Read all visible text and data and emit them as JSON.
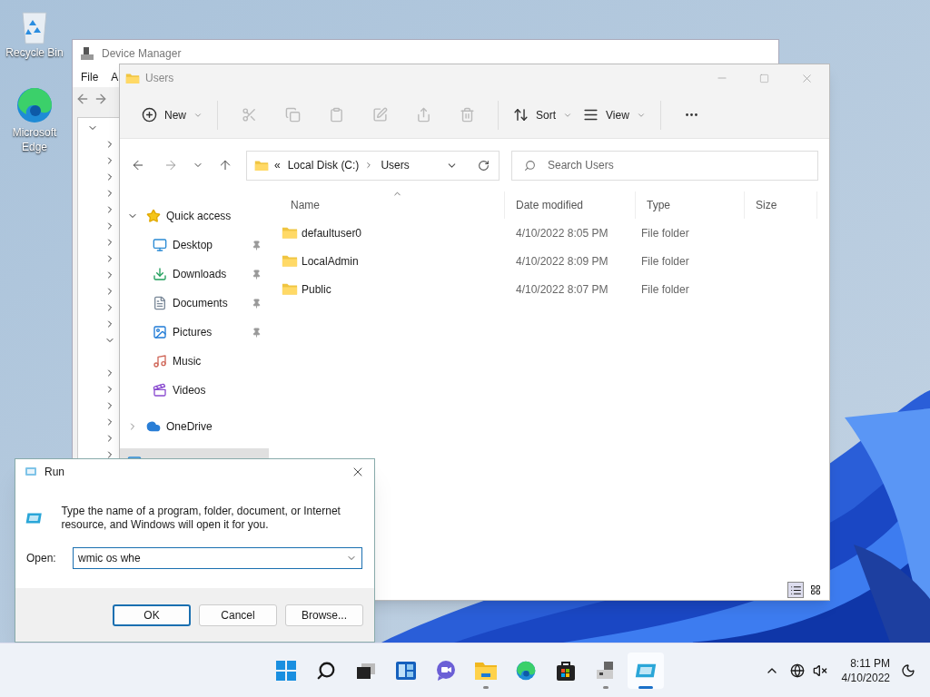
{
  "desktop": {
    "icons": [
      {
        "kind": "recycle",
        "label": "Recycle Bin"
      },
      {
        "kind": "edge",
        "label": "Microsoft Edge"
      }
    ]
  },
  "device_manager": {
    "title": "Device Manager",
    "menu": [
      "File",
      "A"
    ],
    "tree": {
      "expanded": true,
      "children": [
        {
          "expanded": false
        },
        {
          "expanded": false
        },
        {
          "expanded": false
        },
        {
          "expanded": false
        },
        {
          "expanded": false
        },
        {
          "expanded": false
        },
        {
          "expanded": false
        },
        {
          "expanded": false
        },
        {
          "expanded": false
        },
        {
          "expanded": false
        },
        {
          "expanded": false
        },
        {
          "expanded": false
        },
        {
          "expanded": true
        },
        {
          "expanded": false
        },
        {
          "expanded": false
        },
        {
          "expanded": false
        },
        {
          "expanded": false
        },
        {
          "expanded": false
        },
        {
          "expanded": false
        }
      ]
    }
  },
  "explorer": {
    "title": "Users",
    "toolbar": [
      {
        "kind": "new",
        "label": "New",
        "disabled": false
      },
      {
        "kind": "cut",
        "disabled": true
      },
      {
        "kind": "copy",
        "disabled": true
      },
      {
        "kind": "paste",
        "disabled": true
      },
      {
        "kind": "rename",
        "disabled": true
      },
      {
        "kind": "share",
        "disabled": true
      },
      {
        "kind": "delete",
        "disabled": true
      },
      {
        "kind": "sort",
        "label": "Sort",
        "disabled": false
      },
      {
        "kind": "view",
        "label": "View",
        "disabled": false
      },
      {
        "kind": "more",
        "disabled": false
      }
    ],
    "address": {
      "overflow": "«",
      "path": [
        "Local Disk (C:)",
        "Users"
      ]
    },
    "search": {
      "placeholder": "Search Users"
    },
    "nav": [
      {
        "kind": "star",
        "label": "Quick access",
        "expanded": true,
        "selected": false,
        "children": [
          {
            "kind": "desktop",
            "label": "Desktop",
            "pinned": true,
            "selected": false
          },
          {
            "kind": "downloads",
            "label": "Downloads",
            "pinned": true,
            "selected": false
          },
          {
            "kind": "documents",
            "label": "Documents",
            "pinned": true,
            "selected": false
          },
          {
            "kind": "pictures",
            "label": "Pictures",
            "pinned": true,
            "selected": false
          },
          {
            "kind": "music",
            "label": "Music",
            "pinned": false,
            "selected": false
          },
          {
            "kind": "videos",
            "label": "Videos",
            "pinned": false,
            "selected": false
          }
        ]
      },
      {
        "kind": "cloud",
        "label": "OneDrive",
        "expanded": false,
        "selected": false
      },
      {
        "kind": "pc",
        "selected": true
      }
    ],
    "columns": [
      {
        "label": "Name",
        "sorted": true
      },
      {
        "label": "Date modified",
        "sorted": false
      },
      {
        "label": "Type",
        "sorted": false
      },
      {
        "label": "Size",
        "sorted": false
      }
    ],
    "rows": [
      {
        "name": "defaultuser0",
        "date": "4/10/2022 8:05 PM",
        "type": "File folder"
      },
      {
        "name": "LocalAdmin",
        "date": "4/10/2022 8:09 PM",
        "type": "File folder"
      },
      {
        "name": "Public",
        "date": "4/10/2022 8:07 PM",
        "type": "File folder"
      }
    ],
    "view_buttons": [
      {
        "kind": "details",
        "selected": true
      },
      {
        "kind": "tiles",
        "selected": false
      }
    ]
  },
  "run": {
    "title": "Run",
    "description": "Type the name of a program, folder, document, or Internet resource, and Windows will open it for you.",
    "open_label": "Open:",
    "value": "wmic os whe",
    "buttons": [
      {
        "label": "OK",
        "default": true
      },
      {
        "label": "Cancel",
        "default": false
      },
      {
        "label": "Browse...",
        "default": false
      }
    ]
  },
  "taskbar": {
    "apps": [
      {
        "kind": "start",
        "running": false,
        "active": false
      },
      {
        "kind": "search",
        "running": false,
        "active": false
      },
      {
        "kind": "taskview",
        "running": false,
        "active": false
      },
      {
        "kind": "widgets",
        "running": false,
        "active": false
      },
      {
        "kind": "chat",
        "running": false,
        "active": false
      },
      {
        "kind": "explorer",
        "running": true,
        "active": false
      },
      {
        "kind": "edge",
        "running": false,
        "active": false
      },
      {
        "kind": "store",
        "running": false,
        "active": false
      },
      {
        "kind": "devmgr",
        "running": true,
        "active": false
      },
      {
        "kind": "run",
        "running": true,
        "active": true
      }
    ],
    "time": "8:11 PM",
    "date": "4/10/2022"
  }
}
